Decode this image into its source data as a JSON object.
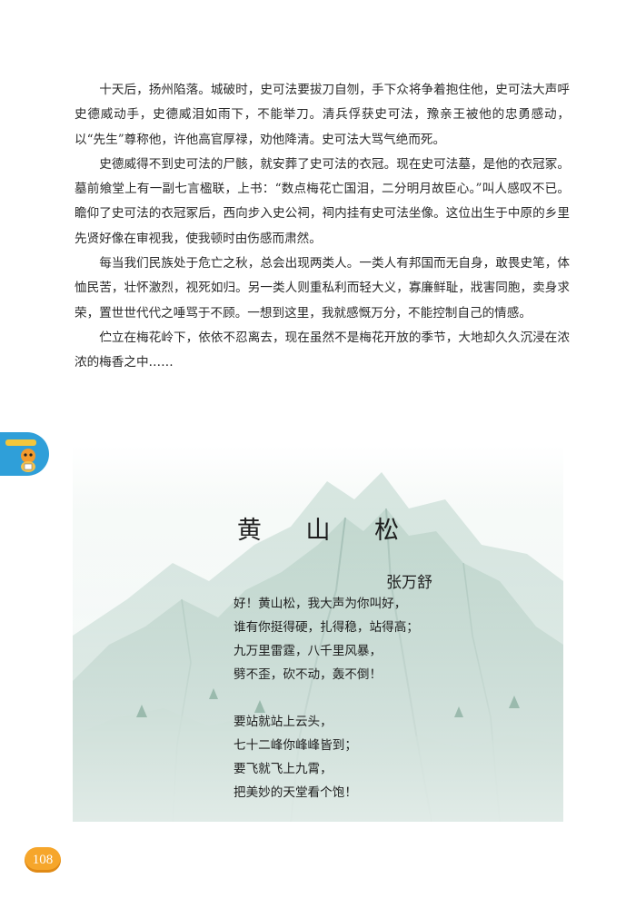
{
  "prose": {
    "paragraphs": [
      "十天后，扬州陷落。城破时，史可法要拔刀自刎，手下众将争着抱住他，史可法大声呼史德威动手，史德威泪如雨下，不能举刀。清兵俘获史可法，豫亲王被他的忠勇感动，以“先生”尊称他，许他高官厚禄，劝他降清。史可法大骂气绝而死。",
      "史德威得不到史可法的尸骸，就安葬了史可法的衣冠。现在史可法墓，是他的衣冠冢。墓前飨堂上有一副七言楹联，上书：“数点梅花亡国泪，二分明月故臣心。”叫人感叹不已。瞻仰了史可法的衣冠冢后，西向步入史公祠，祠内挂有史可法坐像。这位出生于中原的乡里先贤好像在审视我，使我顿时由伤感而肃然。",
      "每当我们民族处于危亡之秋，总会出现两类人。一类人有邦国而无自身，敢畏史笔，体恤民苦，壮怀激烈，视死如归。另一类人则重私利而轻大义，寡廉鲜耻，戕害同胞，卖身求荣，置世世代代之唾骂于不顾。一想到这里，我就感慨万分，不能控制自己的情感。",
      "伫立在梅花岭下，依依不忍离去，现在虽然不是梅花开放的季节，大地却久久沉浸在浓浓的梅香之中……"
    ]
  },
  "poem": {
    "title": "黄 山 松",
    "author": "张万舒",
    "stanzas": [
      [
        "好！黄山松，我大声为你叫好，",
        "谁有你挺得硬，扎得稳，站得高；",
        "九万里雷霆，八千里风暴，",
        "劈不歪，砍不动，轰不倒！"
      ],
      [
        "要站就站上云头，",
        "七十二峰你峰峰皆到；",
        "要飞就飞上九霄，",
        "把美妙的天堂看个饱！"
      ]
    ]
  },
  "page_number": "108",
  "colors": {
    "tab_blue": "#2f9fd9",
    "page_badge": "#f6a62b",
    "mountain_green": "#8fb4a8"
  }
}
